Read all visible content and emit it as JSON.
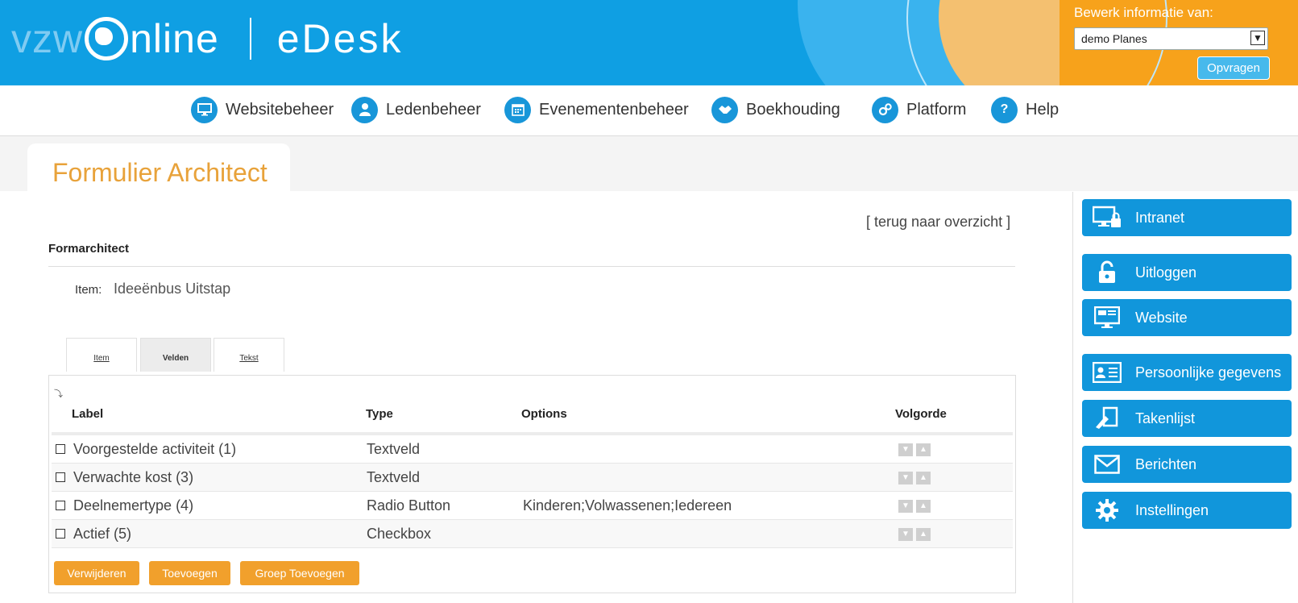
{
  "header": {
    "logo_vzw": "vzw",
    "logo_online": "nline",
    "logo_product": "eDesk",
    "edit_label": "Bewerk informatie van:",
    "select_value": "demo Planes",
    "request_button": "Opvragen"
  },
  "nav": {
    "items": [
      {
        "label": "Websitebeheer",
        "icon": "monitor-icon"
      },
      {
        "label": "Ledenbeheer",
        "icon": "person-icon"
      },
      {
        "label": "Evenementenbeheer",
        "icon": "calendar-icon"
      },
      {
        "label": "Boekhouding",
        "icon": "handshake-icon"
      },
      {
        "label": "Platform",
        "icon": "gears-icon"
      },
      {
        "label": "Help",
        "icon": "question-icon"
      }
    ]
  },
  "page": {
    "title": "Formulier Architect",
    "back_link": "[ terug naar overzicht ]",
    "section_title": "Formarchitect",
    "item_label": "Item:",
    "item_value": "Ideeënbus Uitstap"
  },
  "tabs": [
    {
      "label": "Item",
      "active": false
    },
    {
      "label": "Velden",
      "active": true
    },
    {
      "label": "Tekst",
      "active": false
    }
  ],
  "table": {
    "columns": [
      "Label",
      "Type",
      "Options",
      "Volgorde"
    ],
    "rows": [
      {
        "label": "Voorgestelde activiteit (1)",
        "type": "Textveld",
        "options": ""
      },
      {
        "label": "Verwachte kost (3)",
        "type": "Textveld",
        "options": ""
      },
      {
        "label": "Deelnemertype (4)",
        "type": "Radio Button",
        "options": "Kinderen;Volwassenen;Iedereen"
      },
      {
        "label": "Actief (5)",
        "type": "Checkbox",
        "options": ""
      }
    ]
  },
  "actions": {
    "delete": "Verwijderen",
    "add": "Toevoegen",
    "add_group": "Groep Toevoegen"
  },
  "sidebar": {
    "items": [
      {
        "label": "Intranet",
        "icon": "monitor-lock-icon"
      },
      {
        "label": "Uitloggen",
        "icon": "unlock-icon"
      },
      {
        "label": "Website",
        "icon": "website-icon"
      },
      {
        "label": "Persoonlijke gegevens",
        "icon": "id-card-icon"
      },
      {
        "label": "Takenlijst",
        "icon": "task-icon"
      },
      {
        "label": "Berichten",
        "icon": "envelope-icon"
      },
      {
        "label": "Instellingen",
        "icon": "gear-icon"
      }
    ]
  },
  "colors": {
    "brand_blue": "#0f9fe3",
    "accent_orange": "#f7a21b",
    "button_orange": "#f1a02c",
    "sidebar_blue": "#1196db",
    "title_orange": "#e8a23a"
  }
}
